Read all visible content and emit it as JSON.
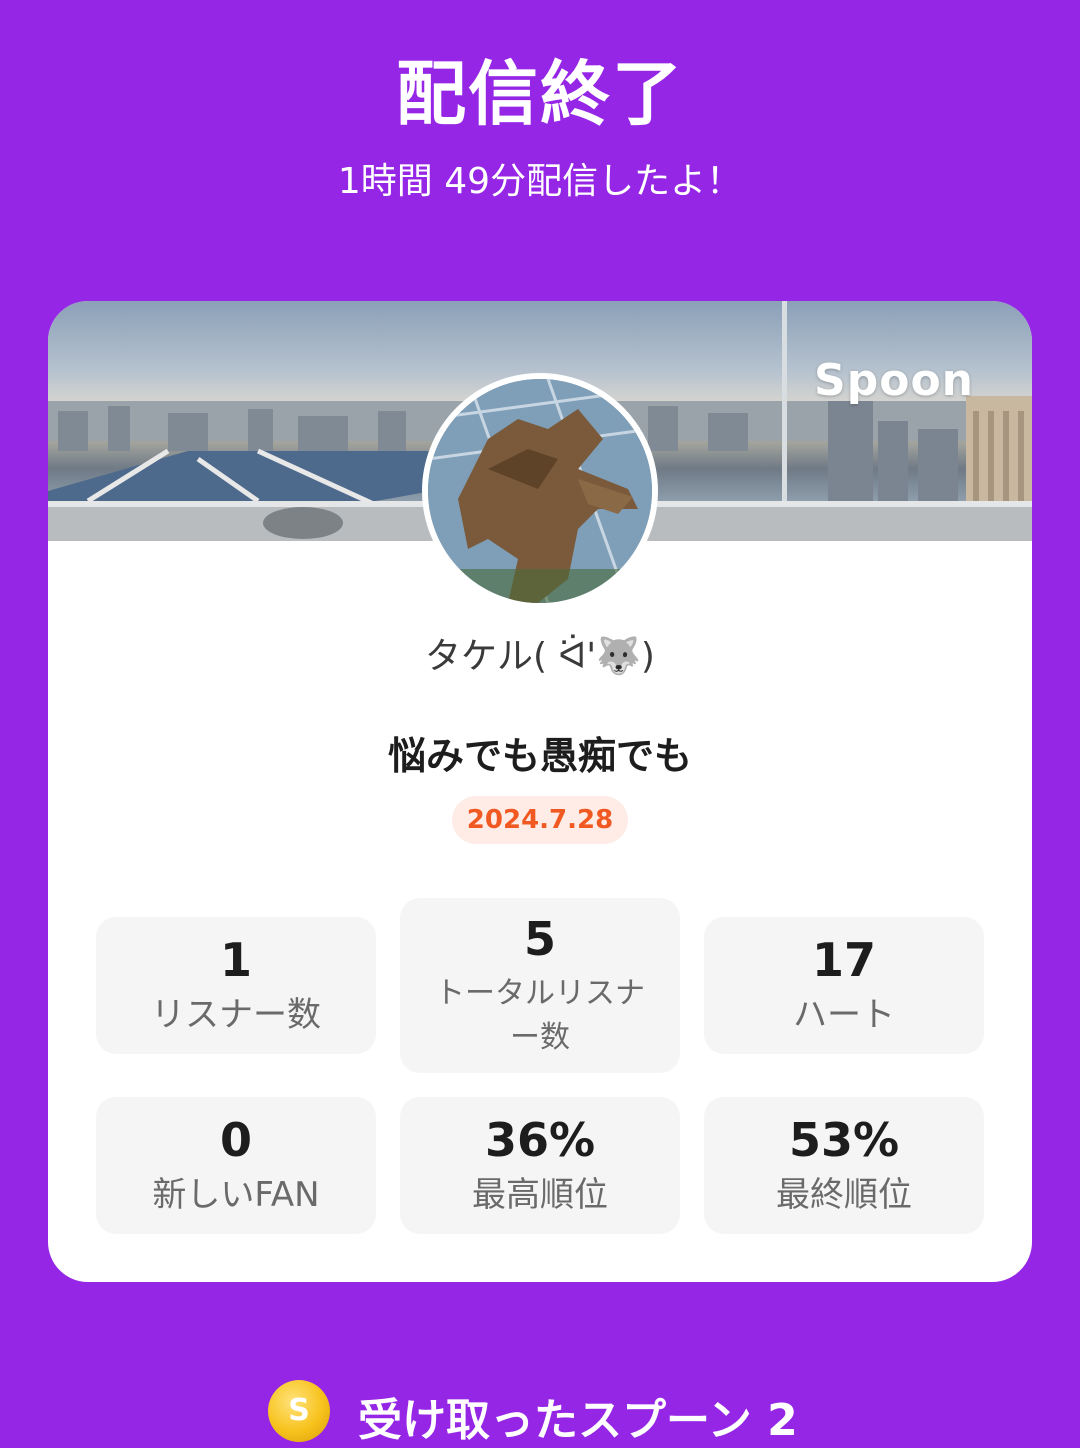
{
  "header": {
    "title": "配信終了",
    "subtitle": "1時間 49分配信したよ！"
  },
  "card": {
    "brand": "Spoon",
    "username": "タケル( ᐛ'🐺)",
    "broadcast_title": "悩みでも愚痴でも",
    "date": "2024.7.28",
    "stats": [
      {
        "value": "1",
        "label": "リスナー数"
      },
      {
        "value": "5",
        "label_line1": "トータルリスナ",
        "label_line2": "ー数"
      },
      {
        "value": "17",
        "label": "ハート"
      },
      {
        "value": "0",
        "label": "新しいFAN"
      },
      {
        "value": "36%",
        "label": "最高順位"
      },
      {
        "value": "53%",
        "label": "最終順位"
      }
    ]
  },
  "spoons": {
    "icon": "spoon-coin-icon",
    "coin_letter": "S",
    "label": "受け取ったスプーン 2"
  },
  "colors": {
    "background": "#9526e6",
    "date_text": "#f05a22",
    "date_bg": "#ffece6",
    "coin": "#f7c21c"
  }
}
